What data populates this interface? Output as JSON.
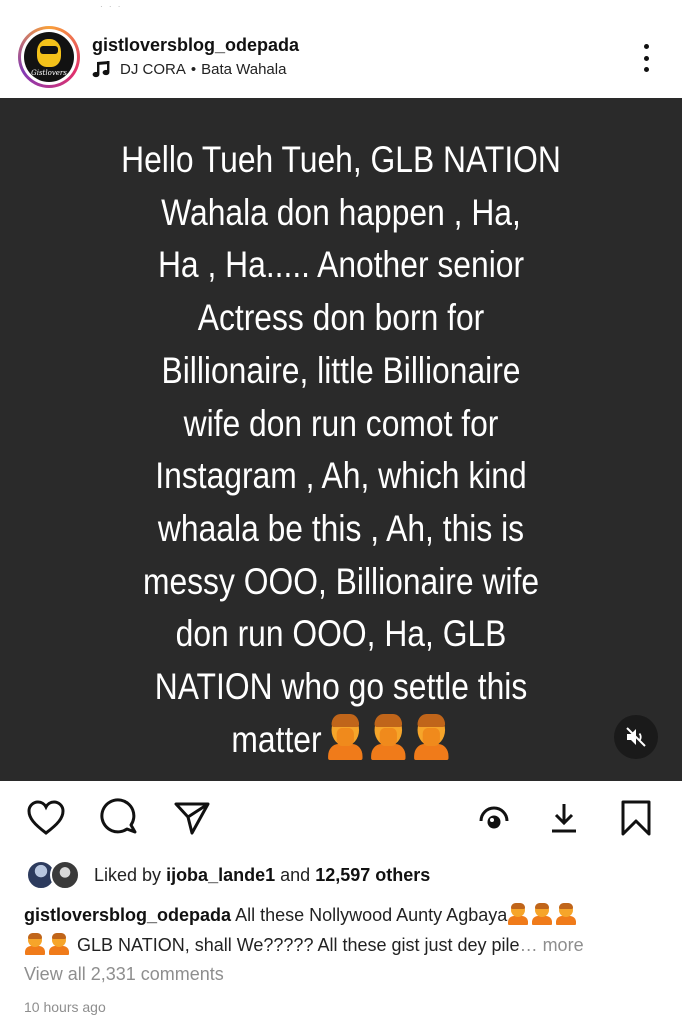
{
  "header": {
    "username": "gistloversblog_odepada",
    "music_artist": "DJ CORA",
    "music_separator": "•",
    "music_title": "Bata Wahala",
    "avatar_brand": "Gistlovers"
  },
  "post": {
    "text": "Hello Tueh Tueh, GLB NATION\nWahala don  happen , Ha,\nHa , Ha..... Another senior\nActress don born for\nBillionaire, little Billionaire\nwife don run comot for\nInstagram , Ah, which kind\nwhaala be this , Ah, this is\nmessy OOO, Billionaire wife\ndon run OOO, Ha, GLB\nNATION who go settle this\nmatter",
    "background": "#2a2a2a"
  },
  "likes": {
    "prefix": "Liked by",
    "user": "ijoba_lande1",
    "middle": "and",
    "count": "12,597 others"
  },
  "caption": {
    "username": "gistloversblog_odepada",
    "text_part1": "All these Nollywood Aunty Agbaya",
    "text_part2": "GLB NATION, shall We????? All these gist just dey pile",
    "more": "… more"
  },
  "comments": {
    "view_all": "View all 2,331 comments"
  },
  "timestamp": "10 hours ago",
  "icons": [
    "music-note-icon",
    "more-options-icon",
    "mute-icon",
    "heart-icon",
    "comment-icon",
    "share-icon",
    "view-icon",
    "download-icon",
    "bookmark-icon"
  ]
}
